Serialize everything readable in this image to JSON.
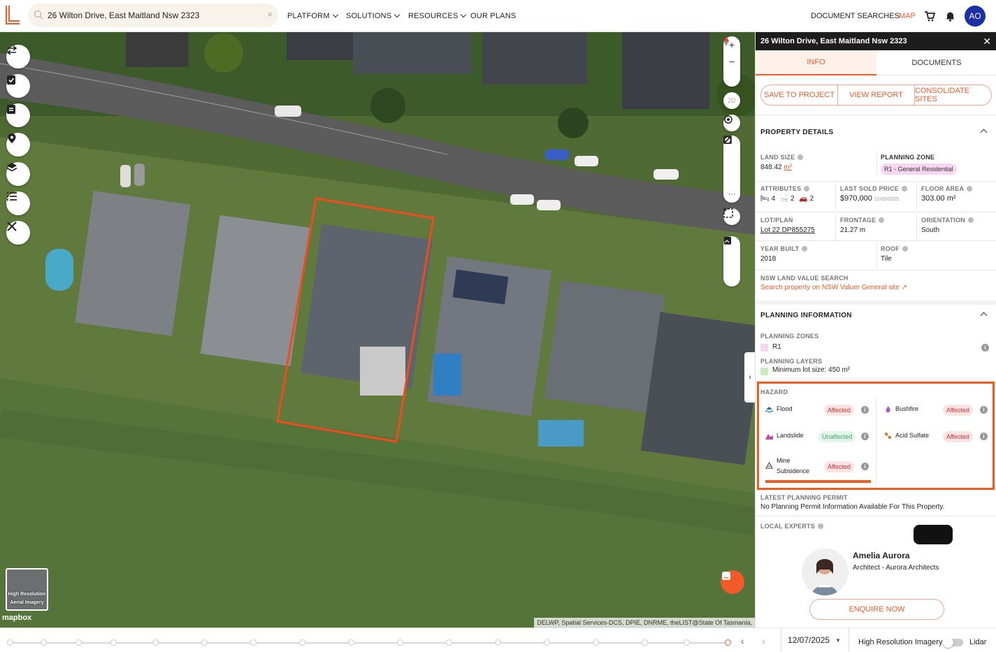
{
  "search": {
    "value": "26 Wilton Drive, East Maitland Nsw 2323",
    "clear": "×"
  },
  "nav": {
    "platform": "PLATFORM",
    "solutions": "SOLUTIONS",
    "resources": "RESOURCES",
    "our_plans": "OUR PLANS",
    "document_searches": "DOCUMENT SEARCHES",
    "map": "MAP",
    "avatar": "AO"
  },
  "colors": {
    "accent": "#f25a2a",
    "avatar": "#1c2fa5",
    "boundary": "#f24a1e"
  },
  "map_controls": {
    "left_tools": [
      "compare-icon",
      "checklist-icon",
      "clipboard-icon",
      "map-pin-icon",
      "layers-icon",
      "list-icon",
      "ruler-tools-icon"
    ],
    "right_2d": "2D",
    "right_more": "···"
  },
  "aerial_thumb": "High Resolution Aerial Imagery",
  "mapbox": "mapbox",
  "attribution": "DELWP, Spatial Services-DCS, DPIE, DNRME, theLIST@State Of Tasmania,",
  "panel": {
    "title": "26 Wilton Drive, East Maitland Nsw 2323",
    "tabs": [
      "INFO",
      "DOCUMENTS"
    ],
    "actions": [
      "SAVE TO PROJECT",
      "VIEW REPORT",
      "CONSOLIDATE SITES"
    ],
    "property_details": "PROPERTY DETAILS",
    "land_size_label": "LAND SIZE",
    "land_size_value": "848.42",
    "land_size_unit": "m²",
    "planning_zone_label": "PLANNING ZONE",
    "planning_zone_value": "R1 - General Residential",
    "attributes_label": "ATTRIBUTES",
    "beds": "4",
    "baths": "2",
    "cars": "2",
    "last_sold_label": "LAST SOLD PRICE",
    "last_sold_value": "$970,000",
    "last_sold_date": "21/05/2025",
    "floor_area_label": "FLOOR AREA",
    "floor_area_value": "303.00 m²",
    "lot_label": "LOT/PLAN",
    "lot_value": "Lot 22 DP855275",
    "frontage_label": "FRONTAGE",
    "frontage_value": "21.27 m",
    "orientation_label": "ORIENTATION",
    "orientation_value": "South",
    "year_label": "YEAR BUILT",
    "year_value": "2018",
    "roof_label": "ROOF",
    "roof_value": "Tile",
    "nsw_label": "NSW LAND VALUE SEARCH",
    "nsw_link": "Search property on NSW Valuer General site",
    "planning_info": "PLANNING INFORMATION",
    "planning_zones_label": "PLANNING ZONES",
    "planning_zones_value": "R1",
    "planning_layers_label": "PLANNING LAYERS",
    "planning_layers_value": "Minimum lot size: 450 m²",
    "hazard_label": "HAZARD",
    "hazards": [
      {
        "name": "Flood",
        "status": "Affected"
      },
      {
        "name": "Bushfire",
        "status": "Affected"
      },
      {
        "name": "Landslide",
        "status": "Unaffected"
      },
      {
        "name": "Acid Sulfate",
        "status": "Affected"
      },
      {
        "name": "Mine Subsidence",
        "status": "Affected"
      }
    ],
    "permit_label": "LATEST PLANNING PERMIT",
    "permit_value": "No Planning Permit Information Available For This Property.",
    "experts_label": "LOCAL EXPERTS",
    "expert_name": "Amelia Aurora",
    "expert_title": "Architect - Aurora Architects",
    "enquire": "ENQUIRE NOW"
  },
  "timeline": {
    "date": "12/07/2025",
    "hi_res": "High Resolution Imagery",
    "lidar": "Lidar"
  }
}
